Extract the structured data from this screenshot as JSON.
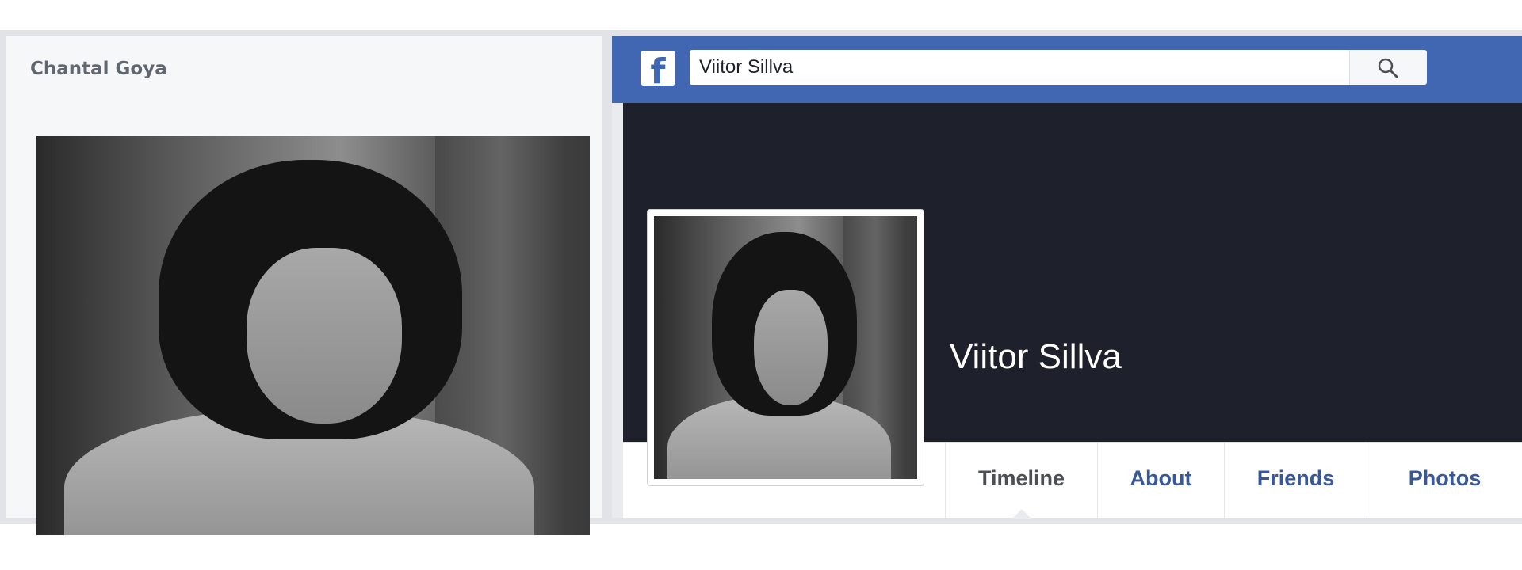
{
  "left_panel": {
    "name": "Chantal Goya",
    "photo_alt": "black-and-white portrait photo"
  },
  "facebook": {
    "logo": "f",
    "search": {
      "value": "Viitor Sillva",
      "icon": "search-icon"
    },
    "profile": {
      "name": "Viitor Sillva",
      "avatar_alt": "profile picture"
    },
    "tabs": [
      {
        "label": "Timeline",
        "active": true
      },
      {
        "label": "About",
        "active": false
      },
      {
        "label": "Friends",
        "active": false
      },
      {
        "label": "Photos",
        "active": false
      }
    ],
    "colors": {
      "brand": "#4267b2",
      "cover": "#1e212b",
      "tab_link": "#385898"
    }
  }
}
